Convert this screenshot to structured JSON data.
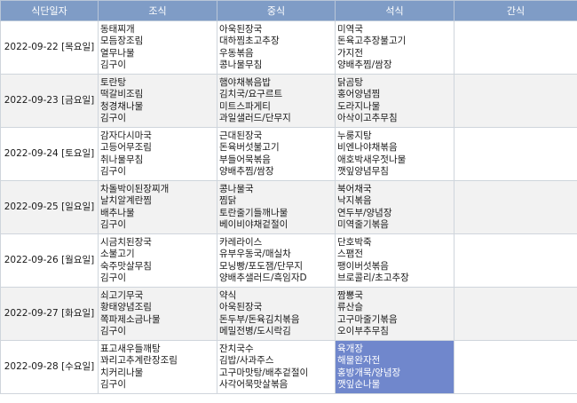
{
  "headers": {
    "date": "식단일자",
    "breakfast": "조식",
    "lunch": "중식",
    "dinner": "석식",
    "snack": "간식"
  },
  "days": [
    {
      "date": "2022-09-22 [목요일]",
      "breakfast": [
        "동태찌개",
        "모듬장조림",
        "열무나물",
        "김구이"
      ],
      "lunch": [
        "아욱된장국",
        "대하찜초고추장",
        "우동볶음",
        "콩나물무침"
      ],
      "dinner": [
        "미역국",
        "돈육고추장불고기",
        "가지전",
        "양배추찜/쌈장"
      ],
      "snack": []
    },
    {
      "date": "2022-09-23 [금요일]",
      "breakfast": [
        "토란탕",
        "떡갈비조림",
        "청경채나물",
        "김구이"
      ],
      "lunch": [
        "햄야채볶음밥",
        "김치국/요구르트",
        "미트스파게티",
        "과일샐러드/단무지"
      ],
      "dinner": [
        "닭곰탕",
        "홍어양념찜",
        "도라지나물",
        "아삭이고추무침"
      ],
      "snack": []
    },
    {
      "date": "2022-09-24 [토요일]",
      "breakfast": [
        "감자다시마국",
        "고등어무조림",
        "취나물무침",
        "김구이"
      ],
      "lunch": [
        "근대된장국",
        "돈육버섯불고기",
        "부들어묵볶음",
        "양배추찜/쌈장"
      ],
      "dinner": [
        "누룽지탕",
        "비엔나야채볶음",
        "애호박새우젓나물",
        "깻잎양념무침"
      ],
      "snack": []
    },
    {
      "date": "2022-09-25 [일요일]",
      "breakfast": [
        "차돌박이된장찌개",
        "날치알계란찜",
        "배추나물",
        "김구이"
      ],
      "lunch": [
        "콩나물국",
        "찜닭",
        "토란줄기들깨나물",
        "베이비야채겉절이"
      ],
      "dinner": [
        "북어채국",
        "낙지볶음",
        "연두부/양념장",
        "미역줄기볶음"
      ],
      "snack": []
    },
    {
      "date": "2022-09-26 [월요일]",
      "breakfast": [
        "시금치된장국",
        "소불고기",
        "숙주맛살무침",
        "김구이"
      ],
      "lunch": [
        "카레라이스",
        "유부우동국/매실차",
        "모닝빵/포도잼/단무지",
        "양배추샐러드/흑임자D"
      ],
      "dinner": [
        "단호박죽",
        "스팸전",
        "팽이버섯볶음",
        "브로콜리/초고추장"
      ],
      "snack": []
    },
    {
      "date": "2022-09-27 [화요일]",
      "breakfast": [
        "쇠고기무국",
        "황태양념조림",
        "쪽파제소금나물",
        "김구이"
      ],
      "lunch": [
        "약식",
        "아욱된장국",
        "돈두부/돈육김치볶음",
        "메밀전병/도시락김"
      ],
      "dinner": [
        "짬뽕국",
        "류산슬",
        "고구마줄기볶음",
        "오이부추무침"
      ],
      "snack": []
    },
    {
      "date": "2022-09-28 [수요일]",
      "breakfast": [
        "표고새우들깨탕",
        "꽈리고추계란장조림",
        "치커리나물",
        "김구이"
      ],
      "lunch": [
        "잔치국수",
        "김밥/사과주스",
        "고구마맛탕/배추겉절이",
        "사각어묵맛살볶음"
      ],
      "dinner": [
        "육개장",
        "해물완자전",
        "홍방개묵/양념장",
        "깻잎순나물"
      ],
      "snack": []
    }
  ]
}
